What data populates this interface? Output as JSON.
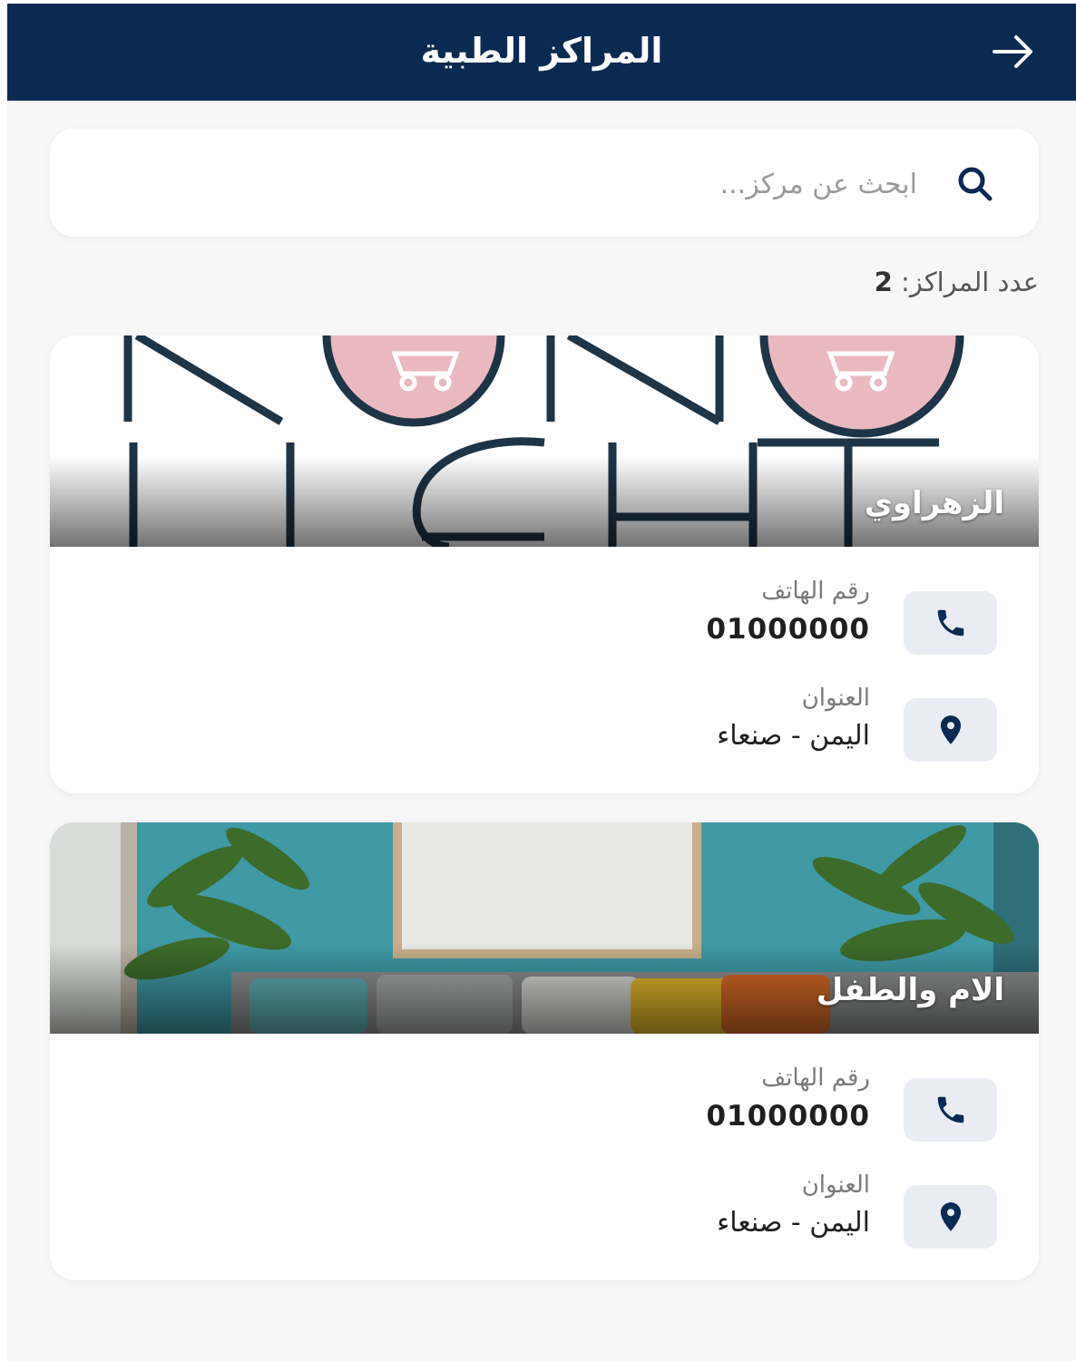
{
  "appbar": {
    "title": "المراكز الطبية",
    "back_icon": "arrow-right-icon"
  },
  "search": {
    "placeholder": "ابحث عن مركز...",
    "value": "",
    "icon": "search-icon"
  },
  "summary": {
    "label": "عدد المراكز:",
    "count": "2"
  },
  "centers": [
    {
      "name": "الزهراوي",
      "phone_label": "رقم الهاتف",
      "phone": "01000000",
      "address_label": "العنوان",
      "address": "اليمن - صنعاء"
    },
    {
      "name": "الام والطفل",
      "phone_label": "رقم الهاتف",
      "phone": "01000000",
      "address_label": "العنوان",
      "address": "اليمن - صنعاء"
    }
  ],
  "colors": {
    "appbar": "#0b2a52",
    "icon": "#0b2a52",
    "icon_bg": "#e9edf3",
    "background": "#f7f7f8"
  }
}
